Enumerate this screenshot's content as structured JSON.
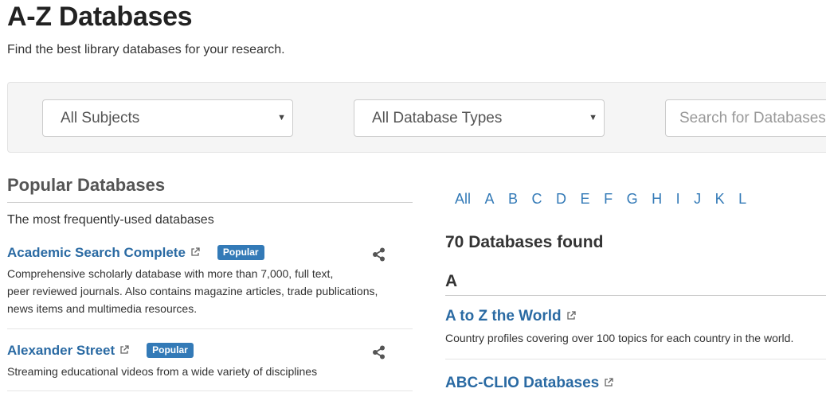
{
  "page": {
    "title": "A-Z Databases",
    "subtitle": "Find the best library databases for your research."
  },
  "filters": {
    "subjects": "All Subjects",
    "types": "All Database Types",
    "search_placeholder": "Search for Databases"
  },
  "popular": {
    "heading": "Popular Databases",
    "lead": "The most frequently-used databases",
    "items": [
      {
        "name": "Academic Search Complete",
        "badge": "Popular",
        "desc_lines": [
          "Comprehensive scholarly database with more than 7,000, full text,",
          "peer reviewed journals. Also contains magazine articles, trade publications,",
          "news items and multimedia resources."
        ]
      },
      {
        "name": "Alexander Street",
        "badge": "Popular",
        "desc_lines": [
          "Streaming educational videos from a wide variety of disciplines"
        ]
      }
    ]
  },
  "az_nav": {
    "letters": [
      "All",
      "A",
      "B",
      "C",
      "D",
      "E",
      "F",
      "G",
      "H",
      "I",
      "J",
      "K",
      "L"
    ]
  },
  "results": {
    "count_text": "70 Databases found",
    "letter": "A",
    "items": [
      {
        "name": "A to Z the World",
        "desc": "Country profiles covering over 100 topics for each country in the world."
      },
      {
        "name": "ABC-CLIO Databases",
        "desc": ""
      }
    ]
  }
}
